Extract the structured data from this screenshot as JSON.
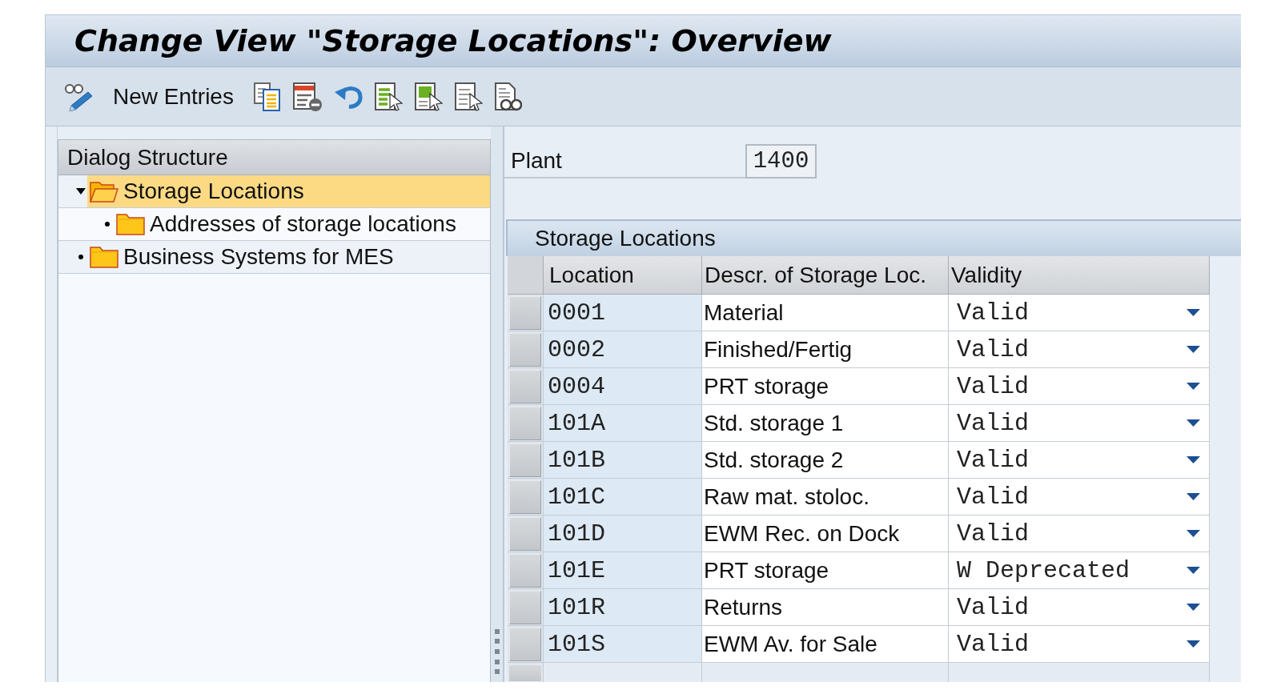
{
  "window": {
    "title": "Change View \"Storage Locations\": Overview"
  },
  "toolbar": {
    "new_entries": "New Entries"
  },
  "dialog_structure": {
    "title": "Dialog Structure",
    "items": [
      {
        "label": "Storage Locations",
        "selected": true,
        "expanded": true,
        "children": [
          {
            "label": "Addresses of storage locations",
            "selected": false
          }
        ]
      },
      {
        "label": "Business Systems for MES",
        "selected": false
      }
    ]
  },
  "plant": {
    "label": "Plant",
    "value": "1400"
  },
  "table": {
    "title": "Storage Locations",
    "columns": [
      "Location",
      "Descr. of Storage Loc.",
      "Validity"
    ],
    "rows": [
      {
        "selected": false,
        "location": "0001",
        "description": "Material",
        "validity": "Valid"
      },
      {
        "selected": false,
        "location": "0002",
        "description": "Finished/Fertig",
        "validity": "Valid"
      },
      {
        "selected": false,
        "location": "0004",
        "description": "PRT storage",
        "validity": "Valid"
      },
      {
        "selected": false,
        "location": "101A",
        "description": "Std. storage 1",
        "validity": "Valid"
      },
      {
        "selected": false,
        "location": "101B",
        "description": "Std. storage 2",
        "validity": "Valid"
      },
      {
        "selected": false,
        "location": "101C",
        "description": "Raw mat. stoloc.",
        "validity": "Valid"
      },
      {
        "selected": false,
        "location": "101D",
        "description": "EWM Rec. on Dock",
        "validity": "Valid"
      },
      {
        "selected": false,
        "location": "101E",
        "description": "PRT storage",
        "validity": "W Deprecated"
      },
      {
        "selected": false,
        "location": "101R",
        "description": "Returns",
        "validity": "Valid"
      },
      {
        "selected": false,
        "location": "101S",
        "description": "EWM Av. for Sale",
        "validity": "Valid"
      }
    ]
  }
}
